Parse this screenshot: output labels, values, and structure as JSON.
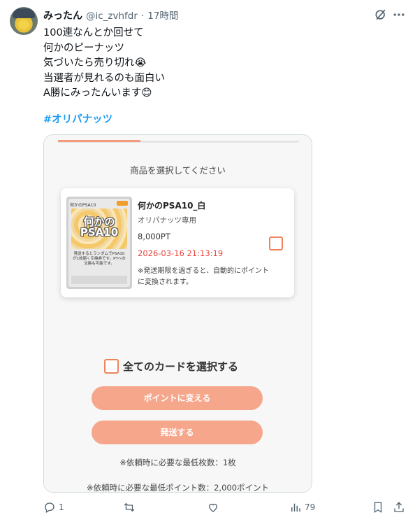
{
  "post": {
    "author_name": "みったん",
    "handle": "@ic_zvhfdr",
    "separator": "·",
    "time": "17時間",
    "lines": [
      "100連なんとか回せて",
      "何かのピーナッツ",
      "気づいたら売り切れ😭",
      "当選者が見れるのも面白い",
      "A勝にみったんいます😊"
    ],
    "hashtag": "#オリパナッツ"
  },
  "app": {
    "select_title": "商品を選択してください",
    "product": {
      "name": "何かのPSA10_白",
      "subtitle": "オリパナッツ専用",
      "price": "8,000PT",
      "deadline": "2026-03-16 21:13:19",
      "note": "※発送期限を過ぎると、自動的にポイントに変換されます。",
      "thumb_label": "何かのPSA10",
      "thumb_title_1": "何かの",
      "thumb_title_2": "PSA10",
      "thumb_text": "発送するとランダムでPSA10が1枚届く引換券です。PTへの交換も可能です。"
    },
    "select_all_label": "全てのカードを選択する",
    "convert_button": "ポイントに変える",
    "ship_button": "発送する",
    "min_cards": "※依頼時に必要な最低枚数：1枚",
    "min_points": "※依頼時に必要な最低ポイント数：2,000ポイント"
  },
  "actions": {
    "reply_count": "1",
    "retweet_count": "",
    "like_count": "",
    "views_count": "79"
  },
  "icons": {
    "grok": "grok-icon",
    "more": "more-icon",
    "reply": "reply-icon",
    "retweet": "retweet-icon",
    "like": "heart-icon",
    "views": "views-icon",
    "bookmark": "bookmark-icon",
    "share": "share-icon"
  },
  "colors": {
    "hashtag": "#1d9bf0",
    "accent_button": "#f6a68a",
    "checkbox_border": "#f0835a",
    "deadline": "#e8453c"
  }
}
